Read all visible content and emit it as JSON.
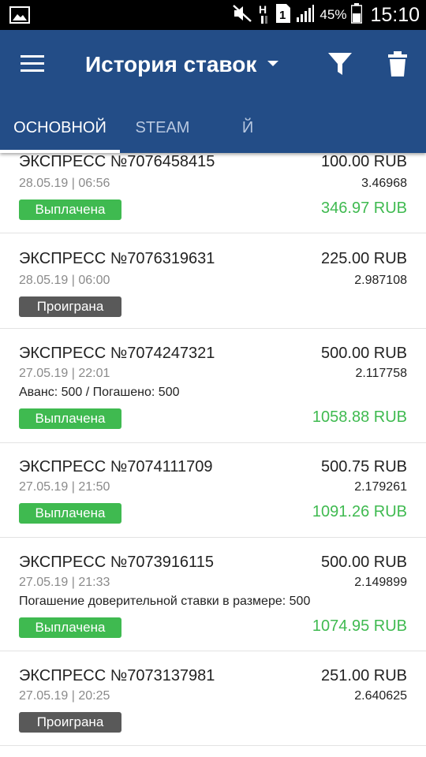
{
  "status_bar": {
    "battery_percent": "45%",
    "time": "15:10",
    "icons": [
      "image-icon",
      "mute-icon",
      "h-network-icon",
      "sim-icon",
      "signal-icon",
      "battery-icon"
    ]
  },
  "app_bar": {
    "title": "История ставок",
    "colors": {
      "primary": "#234d87",
      "won": "#3fba50",
      "lost": "#595959"
    },
    "tabs": [
      {
        "label": "ОСНОВНОЙ",
        "active": true
      },
      {
        "label": "STEAM",
        "active": false
      },
      {
        "label": "Й",
        "active": false
      }
    ]
  },
  "bets": [
    {
      "name": "ЭКСПРЕСС №7076458415",
      "date": "28.05.19 | 06:56",
      "stake": "100.00 RUB",
      "coef": "3.46968",
      "status": "Выплачена",
      "payout": "346.97 RUB"
    },
    {
      "name": "ЭКСПРЕСС №7076319631",
      "date": "28.05.19 | 06:00",
      "stake": "225.00 RUB",
      "coef": "2.987108",
      "status": "Проиграна"
    },
    {
      "name": "ЭКСПРЕСС №7074247321",
      "date": "27.05.19 | 22:01",
      "stake": "500.00 RUB",
      "coef": "2.117758",
      "note": "Аванс: 500 / Погашено: 500",
      "status": "Выплачена",
      "payout": "1058.88 RUB"
    },
    {
      "name": "ЭКСПРЕСС №7074111709",
      "date": "27.05.19 | 21:50",
      "stake": "500.75 RUB",
      "coef": "2.179261",
      "status": "Выплачена",
      "payout": "1091.26 RUB"
    },
    {
      "name": "ЭКСПРЕСС №7073916115",
      "date": "27.05.19 | 21:33",
      "stake": "500.00 RUB",
      "coef": "2.149899",
      "note": "Погашение доверительной ставки в размере: 500",
      "status": "Выплачена",
      "payout": "1074.95 RUB"
    },
    {
      "name": "ЭКСПРЕСС №7073137981",
      "date": "27.05.19 | 20:25",
      "stake": "251.00 RUB",
      "coef": "2.640625",
      "status": "Проиграна"
    }
  ]
}
